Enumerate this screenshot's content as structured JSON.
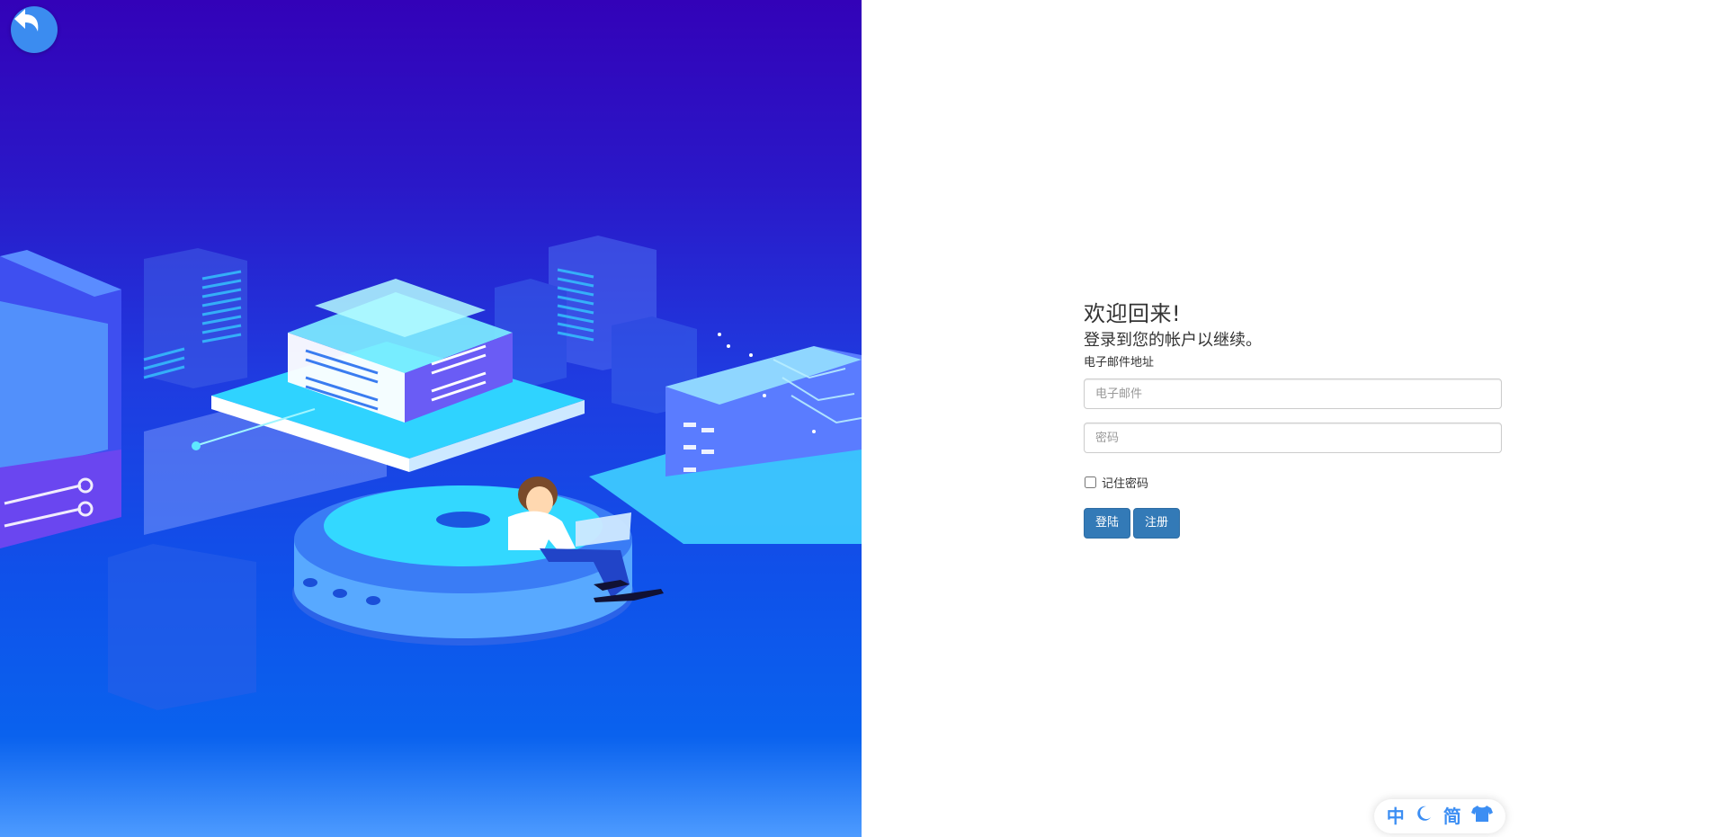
{
  "login": {
    "welcome_title": "欢迎回来!",
    "subtitle": "登录到您的帐户以继续。",
    "email_label": "电子邮件地址",
    "email_placeholder": "电子邮件",
    "email_value": "",
    "password_placeholder": "密码",
    "password_value": "",
    "remember_label": "记住密码",
    "remember_checked": false,
    "login_button": "登陆",
    "register_button": "注册"
  },
  "widget": {
    "chinese_label": "中",
    "simplified_label": "简",
    "moon_icon": "moon-icon",
    "shirt_icon": "shirt-icon"
  },
  "hero": {
    "back_icon": "back-arrow-icon",
    "illustration": "isometric-server-illustration"
  },
  "colors": {
    "primary_button": "#337ab7",
    "widget_accent": "#3c8ef3",
    "hero_top": "#3302b8",
    "hero_bottom": "#4d9bff"
  }
}
